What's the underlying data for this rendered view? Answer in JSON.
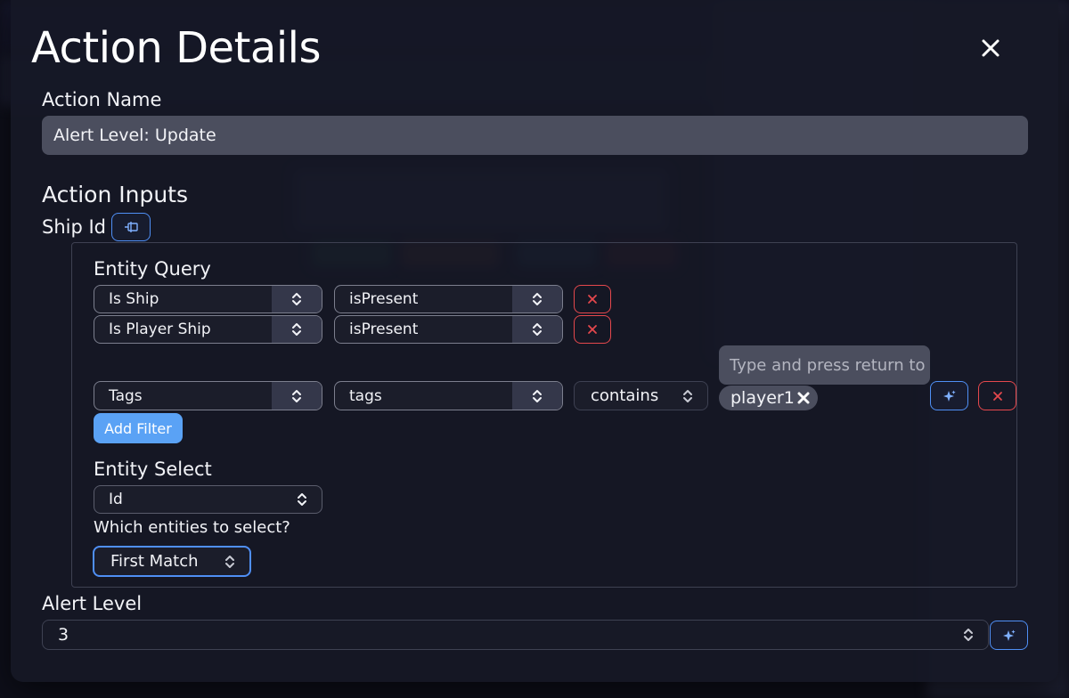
{
  "modal": {
    "title": "Action Details",
    "action_name_label": "Action Name",
    "action_name_value": "Alert Level: Update",
    "action_inputs_title": "Action Inputs",
    "ship_id_label": "Ship Id"
  },
  "entity_query": {
    "title": "Entity Query",
    "filters": [
      {
        "field": "Is Ship",
        "operator": "isPresent"
      },
      {
        "field": "Is Player Ship",
        "operator": "isPresent"
      },
      {
        "field": "Tags",
        "operator": "tags",
        "comparison": "contains",
        "tag_input_placeholder": "Type and press return to",
        "tag": "player1"
      }
    ],
    "add_filter_label": "Add Filter"
  },
  "entity_select": {
    "title": "Entity Select",
    "value": "Id",
    "question": "Which entities to select?",
    "match_value": "First Match"
  },
  "alert_level": {
    "label": "Alert Level",
    "value": "3"
  },
  "colors": {
    "accent": "#4f8ff5",
    "danger": "#e5484d",
    "button": "#5aa2f5"
  },
  "icons": {
    "close": "close-icon",
    "chevron": "updown-chevron-icon",
    "delete": "x-icon",
    "sparkle": "sparkle-icon",
    "component": "component-icon"
  }
}
